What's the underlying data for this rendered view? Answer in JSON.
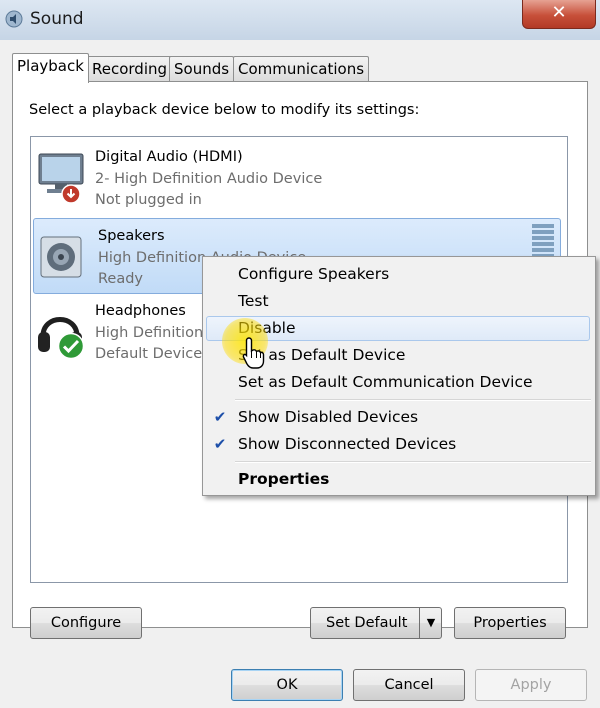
{
  "window": {
    "title": "Sound",
    "close_label": "✕"
  },
  "tabs": [
    {
      "label": "Playback",
      "active": true
    },
    {
      "label": "Recording"
    },
    {
      "label": "Sounds"
    },
    {
      "label": "Communications"
    }
  ],
  "instructions": "Select a playback device below to modify its settings:",
  "devices": [
    {
      "name": "Digital Audio (HDMI)",
      "line2": "2- High Definition Audio Device",
      "line3": "Not plugged in",
      "icon": "monitor-icon",
      "status_icon": "unplugged-arrow-icon"
    },
    {
      "name": "Speakers",
      "line2": "High Definition Audio Device",
      "line3": "Ready",
      "icon": "speaker-icon",
      "selected": true
    },
    {
      "name": "Headphones",
      "line2": "High Definition Audio Device",
      "line3": "Default Device",
      "icon": "headphones-icon",
      "status_icon": "default-check-icon"
    }
  ],
  "buttons": {
    "configure": "Configure",
    "set_default": "Set Default",
    "properties": "Properties",
    "ok": "OK",
    "cancel": "Cancel",
    "apply": "Apply"
  },
  "context_menu": {
    "items": [
      {
        "label": "Configure Speakers"
      },
      {
        "label": "Test"
      },
      {
        "label": "Disable",
        "hover": true
      },
      {
        "label": "Set as Default Device"
      },
      {
        "label": "Set as Default Communication Device"
      },
      {
        "label": "Show Disabled Devices",
        "checked": true
      },
      {
        "label": "Show Disconnected Devices",
        "checked": true
      },
      {
        "label": "Properties",
        "bold": true
      }
    ],
    "check_glyph": "✔"
  },
  "colors": {
    "selection": "#c9e0f8",
    "close_button": "#c7503a",
    "cursor_highlight": "#ffe000"
  }
}
